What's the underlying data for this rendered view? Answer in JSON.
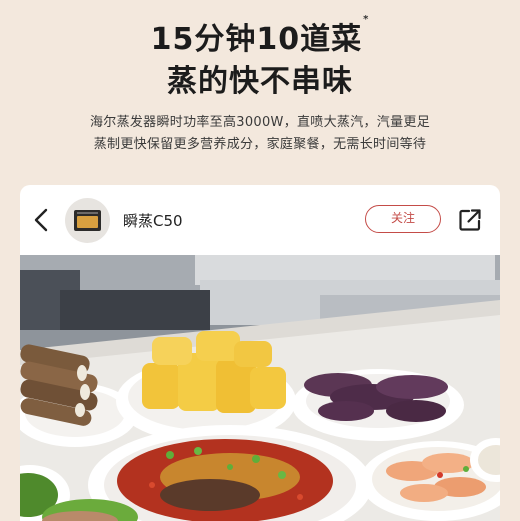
{
  "banner": {
    "headline_line1": "15分钟10道菜",
    "headline_mark": "*",
    "headline_line2": "蒸的快不串味",
    "sub_line1": "海尔蒸发器瞬时功率至高3000W，直喷大蒸汽，汽量更足",
    "sub_line2": "蒸制更快保留更多营养成分，家庭聚餐，无需长时间等待"
  },
  "post": {
    "title": "瞬蒸C50",
    "follow_label": "关注",
    "icons": [
      "chevron-left-icon",
      "share-icon"
    ],
    "accent_color": "#c44c48"
  }
}
